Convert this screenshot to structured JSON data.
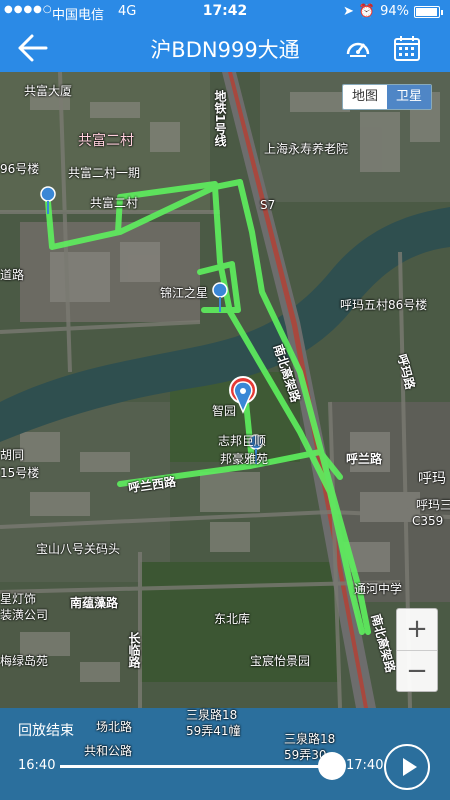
{
  "status_bar": {
    "signal": "●●●●○",
    "carrier": "中国电信",
    "network": "4G",
    "time": "17:42",
    "battery": "94%",
    "battery_level": 0.94
  },
  "nav": {
    "title": "沪BDN999大通",
    "icons": [
      "back-arrow-icon",
      "speedometer-icon",
      "calendar-icon"
    ]
  },
  "map": {
    "type_toggle": {
      "map_label": "地图",
      "satellite_label": "卫星",
      "selected": "卫星"
    },
    "zoom_in": "+",
    "zoom_out": "−",
    "labels": {
      "gongfu_dasha": "共富大厦",
      "metro_line": "地铁1号线",
      "gongfu_ercun": "共富二村",
      "bldg_96": "96号楼",
      "gongfu_ercun_yiqi": "共富二村一期",
      "gongfu_ercun_b": "共富二村",
      "yongshou": "上海永寿养老院",
      "s7": "S7",
      "dao_lu": "道路",
      "jinjiang": "锦江之星",
      "huma5": "呼玛五村86号楼",
      "nanbei_gaojia": "南北高架路",
      "huma_road_v": "呼玛路",
      "zhiyuan": "智园",
      "zhibang": "志邦巨顺",
      "bangjia": "邦豪雅苑",
      "hulan_road": "呼兰路",
      "hutong": "胡同",
      "bldg_15": "15号楼",
      "hulan_west": "呼兰西路",
      "huma_e": "呼玛",
      "huma3c": "呼玛三",
      "c359": "C359",
      "baoshan8": "宝山八号关码头",
      "dengju": "星灯饰",
      "zhuangshi": "装潢公司",
      "nanpu_road": "南蕴藻路",
      "changlin_road": "长临路",
      "dongbeiku": "东北库",
      "tonghe_school": "通河中学",
      "nanbei_gaojia_2": "南北高架路",
      "meilv": "梅绿岛苑",
      "baochen": "宝宸怡景园",
      "sanquan18a": "三泉路18",
      "sanquan41": "59弄41幢",
      "sanquan18b": "三泉路18",
      "sanquan30": "59弄30",
      "changcun_road": "场北路",
      "gongcun_road": "共和公路"
    }
  },
  "playback": {
    "status": "回放结束",
    "start_time": "16:40",
    "end_time": "17:40",
    "progress": 1.0
  },
  "colors": {
    "header": "#2b8ae6",
    "track": "#5ef05e",
    "panel": "#2b76aa",
    "pin": "#3a87d6"
  }
}
